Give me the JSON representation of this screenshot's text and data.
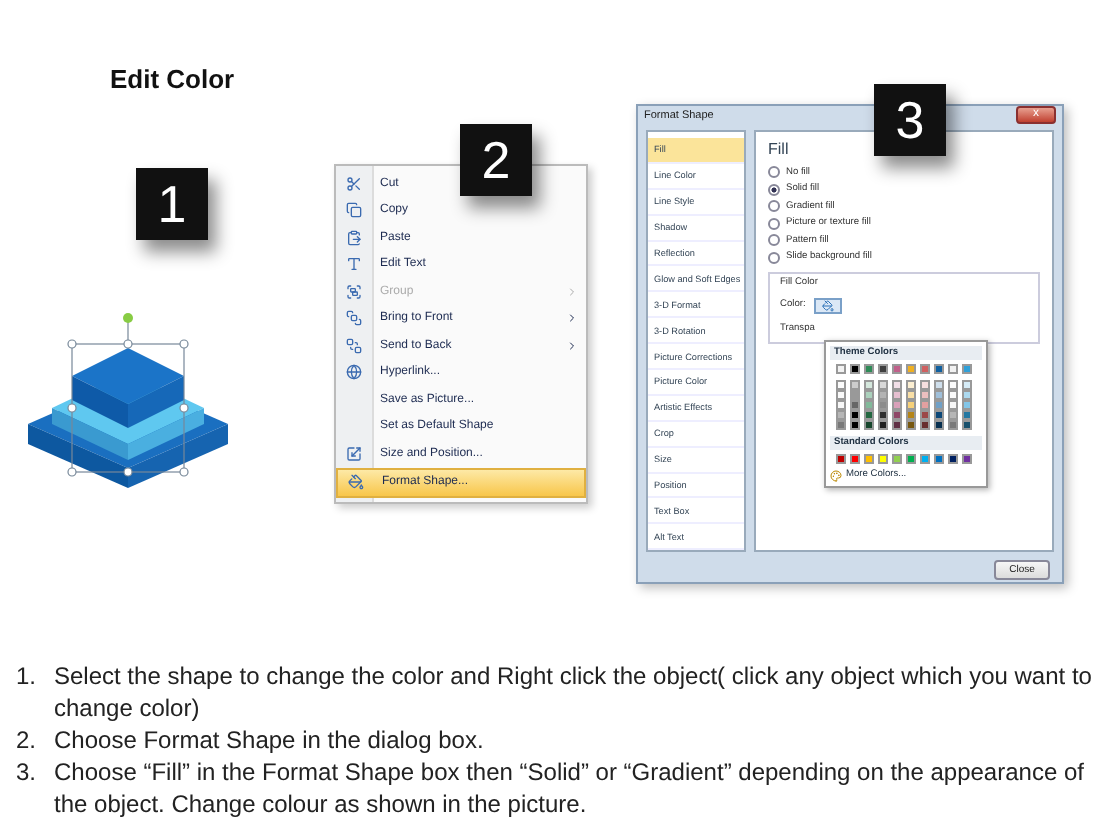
{
  "title": "Edit Color",
  "steps": [
    {
      "label": "1"
    },
    {
      "label": "2"
    },
    {
      "label": "3"
    }
  ],
  "context_menu": {
    "items": [
      {
        "label": "Cut",
        "disabled": false,
        "submenu": false,
        "selected": false
      },
      {
        "label": "Copy",
        "disabled": false,
        "submenu": false,
        "selected": false
      },
      {
        "label": "Paste",
        "disabled": false,
        "submenu": false,
        "selected": false
      },
      {
        "label": "Edit Text",
        "disabled": false,
        "submenu": false,
        "selected": false
      },
      {
        "label": "Group",
        "disabled": true,
        "submenu": true,
        "selected": false
      },
      {
        "label": "Bring to Front",
        "disabled": false,
        "submenu": true,
        "selected": false
      },
      {
        "label": "Send to Back",
        "disabled": false,
        "submenu": true,
        "selected": false
      },
      {
        "label": "Hyperlink...",
        "disabled": false,
        "submenu": false,
        "selected": false
      },
      {
        "label": "Save as Picture...",
        "disabled": false,
        "submenu": false,
        "selected": false
      },
      {
        "label": "Set as Default Shape",
        "disabled": false,
        "submenu": false,
        "selected": false
      },
      {
        "label": "Size and Position...",
        "disabled": false,
        "submenu": false,
        "selected": false
      },
      {
        "label": "Format Shape...",
        "disabled": false,
        "submenu": false,
        "selected": true
      }
    ]
  },
  "dialog": {
    "title": "Format Shape",
    "close_glyph": "x",
    "categories": [
      {
        "label": "Fill",
        "selected": true
      },
      {
        "label": "Line Color",
        "selected": false
      },
      {
        "label": "Line Style",
        "selected": false
      },
      {
        "label": "Shadow",
        "selected": false
      },
      {
        "label": "Reflection",
        "selected": false
      },
      {
        "label": "Glow and Soft Edges",
        "selected": false
      },
      {
        "label": "3-D Format",
        "selected": false
      },
      {
        "label": "3-D Rotation",
        "selected": false
      },
      {
        "label": "Picture Corrections",
        "selected": false
      },
      {
        "label": "Picture Color",
        "selected": false
      },
      {
        "label": "Artistic Effects",
        "selected": false
      },
      {
        "label": "Crop",
        "selected": false
      },
      {
        "label": "Size",
        "selected": false
      },
      {
        "label": "Position",
        "selected": false
      },
      {
        "label": "Text Box",
        "selected": false
      },
      {
        "label": "Alt Text",
        "selected": false
      }
    ],
    "pane_title": "Fill",
    "fill_options": [
      {
        "label": "No fill",
        "selected": false
      },
      {
        "label": "Solid fill",
        "selected": true
      },
      {
        "label": "Gradient fill",
        "selected": false
      },
      {
        "label": "Picture or texture fill",
        "selected": false
      },
      {
        "label": "Pattern fill",
        "selected": false
      },
      {
        "label": "Slide background fill",
        "selected": false
      }
    ],
    "fill_color_group": "Fill Color",
    "color_label": "Color:",
    "transparency_label": "Transpa",
    "close_button": "Close"
  },
  "color_dropdown": {
    "theme_title": "Theme Colors",
    "theme_colors": [
      {
        "color": "#f2f2f2"
      },
      {
        "color": "#000000"
      },
      {
        "color": "#2e8b57"
      },
      {
        "color": "#404040"
      },
      {
        "color": "#c0608a"
      },
      {
        "color": "#f0b020"
      },
      {
        "color": "#d06060"
      },
      {
        "color": "#1060a0"
      },
      {
        "color": "#f2f2f2"
      },
      {
        "color": "#30a0d8"
      }
    ],
    "standard_title": "Standard Colors",
    "standard_colors": [
      {
        "color": "#c00000"
      },
      {
        "color": "#ff0000"
      },
      {
        "color": "#ffc000"
      },
      {
        "color": "#ffff00"
      },
      {
        "color": "#92d050"
      },
      {
        "color": "#00b050"
      },
      {
        "color": "#00b0f0"
      },
      {
        "color": "#0070c0"
      },
      {
        "color": "#002060"
      },
      {
        "color": "#7030a0"
      }
    ],
    "more_colors": "More Colors..."
  },
  "instructions": [
    {
      "number": "1.",
      "text": "Select the shape to change the color and Right click the object( click any object which you want to change color)"
    },
    {
      "number": "2.",
      "text": "Choose Format Shape in the dialog box."
    },
    {
      "number": "3.",
      "text": "Choose “Fill” in the Format Shape box then “Solid” or “Gradient” depending on the appearance of the object. Change colour as shown in the picture."
    }
  ]
}
